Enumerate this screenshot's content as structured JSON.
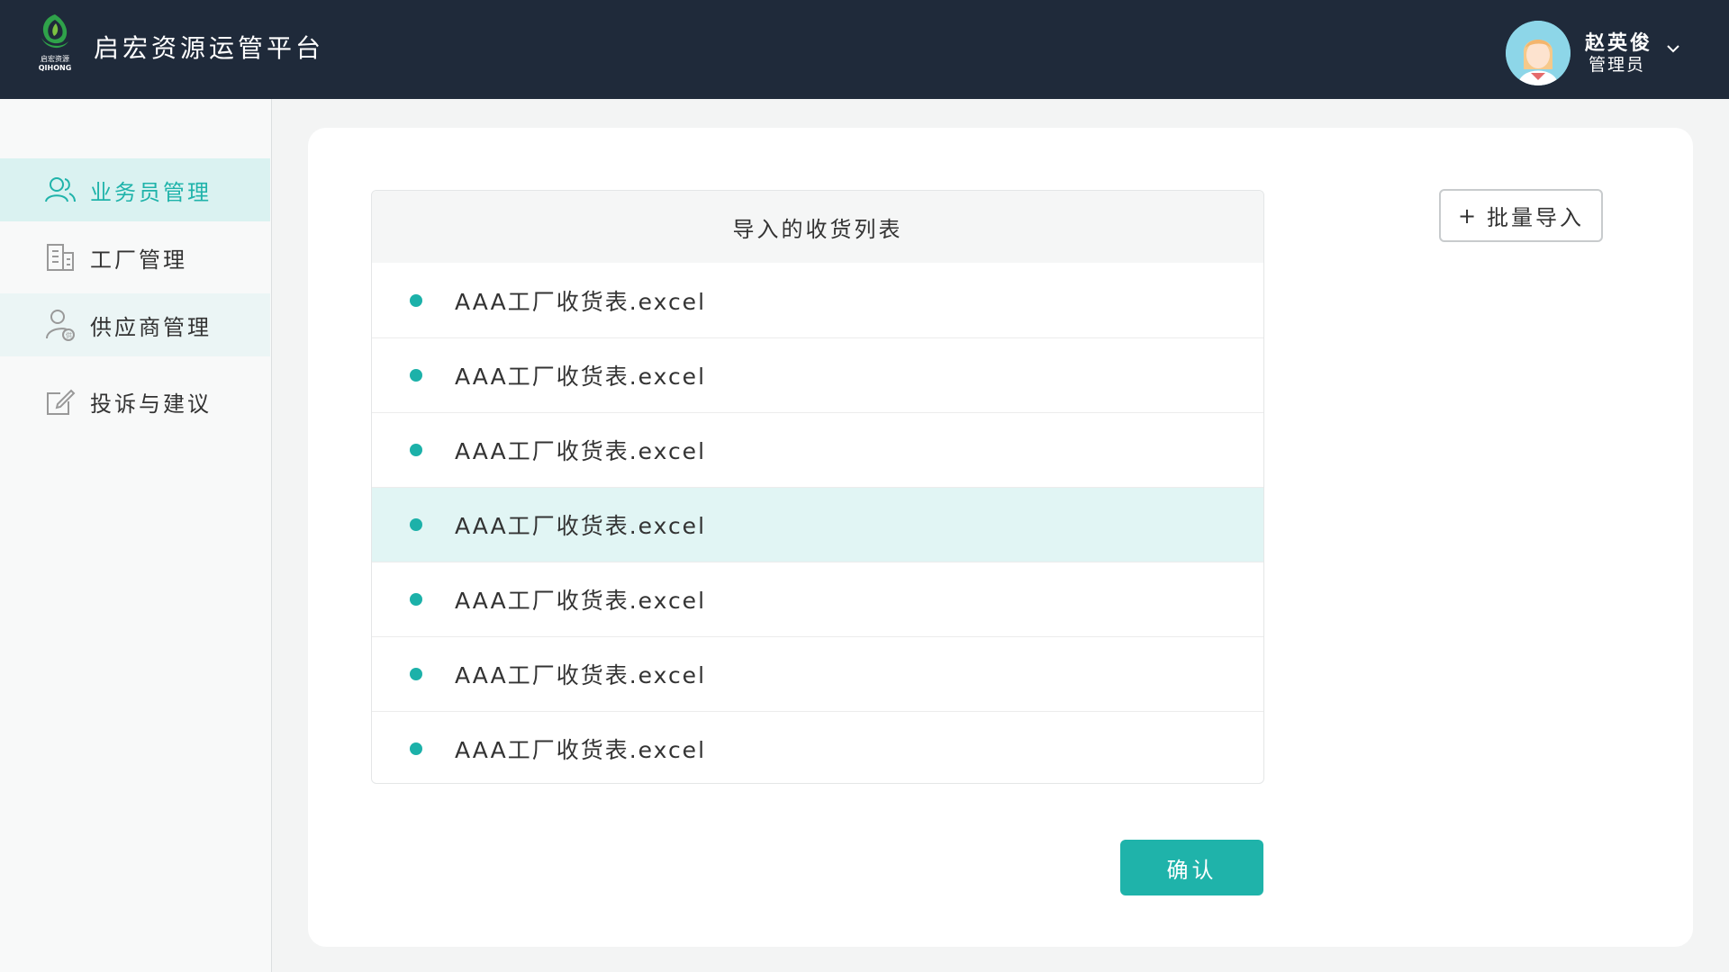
{
  "app": {
    "title": "启宏资源运管平台",
    "logo_cn": "启宏资源",
    "logo_en": "QIHONG"
  },
  "user": {
    "name": "赵英俊",
    "role": "管理员"
  },
  "sidebar": {
    "items": [
      {
        "label": "业务员管理",
        "icon": "users-icon",
        "state": "active"
      },
      {
        "label": "工厂管理",
        "icon": "building-icon",
        "state": "normal"
      },
      {
        "label": "供应商管理",
        "icon": "supplier-icon",
        "state": "highlighted"
      },
      {
        "label": "投诉与建议",
        "icon": "edit-icon",
        "state": "normal"
      }
    ]
  },
  "main": {
    "list_title": "导入的收货列表",
    "rows": [
      {
        "text": "AAA工厂收货表.excel",
        "selected": false
      },
      {
        "text": "AAA工厂收货表.excel",
        "selected": false
      },
      {
        "text": "AAA工厂收货表.excel",
        "selected": false
      },
      {
        "text": "AAA工厂收货表.excel",
        "selected": true
      },
      {
        "text": "AAA工厂收货表.excel",
        "selected": false
      },
      {
        "text": "AAA工厂收货表.excel",
        "selected": false
      },
      {
        "text": "AAA工厂收货表.excel",
        "selected": false
      }
    ],
    "import_button": {
      "plus": "+",
      "label": "批量导入"
    },
    "confirm_button": "确认"
  },
  "colors": {
    "header_bg": "#1f2a3a",
    "accent": "#1fb3aa",
    "active_nav_bg": "#daf2f1",
    "selected_row_bg": "#e1f5f4"
  }
}
